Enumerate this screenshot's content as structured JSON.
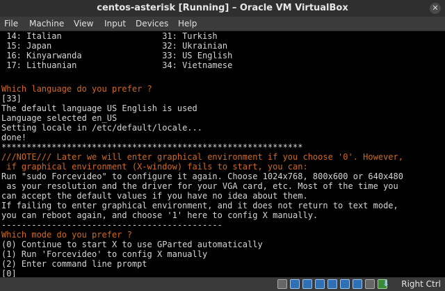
{
  "window": {
    "title": "centos-asterisk [Running] – Oracle VM VirtualBox",
    "close_glyph": "✕"
  },
  "menu": {
    "items": [
      "File",
      "Machine",
      "View",
      "Input",
      "Devices",
      "Help"
    ]
  },
  "console": {
    "lines": [
      {
        "text": " 14: Italian                    31: Turkish",
        "color": "white"
      },
      {
        "text": " 15: Japan                      32: Ukrainian",
        "color": "white"
      },
      {
        "text": " 16: Kinyarwanda                33: US English",
        "color": "white"
      },
      {
        "text": " 17: Lithuanian                 34: Vietnamese",
        "color": "white"
      },
      {
        "text": "",
        "color": "white"
      },
      {
        "text": "",
        "color": "white"
      },
      {
        "text": "Which language do you prefer ?",
        "color": "orange"
      },
      {
        "text": "[33]",
        "color": "white"
      },
      {
        "text": "The default language US English is used",
        "color": "white"
      },
      {
        "text": "Language selected en_US",
        "color": "white"
      },
      {
        "text": "Setting locale in /etc/default/locale...",
        "color": "white"
      },
      {
        "text": "done!",
        "color": "white"
      },
      {
        "text": "************************************************************",
        "color": "white"
      },
      {
        "text": "///NOTE/// Later we will enter graphical environment if you choose '0'. However,",
        "color": "orange"
      },
      {
        "text": " if graphical environment (X-window) fails to start, you can:",
        "color": "orange"
      },
      {
        "text": "Run \"sudo Forcevideo\" to configure it again. Choose 1024x768, 800x600 or 640x480",
        "color": "white"
      },
      {
        "text": " as your resolution and the driver for your VGA card, etc. Most of the time you",
        "color": "white"
      },
      {
        "text": "can accept the default values if you have no idea about them.",
        "color": "white"
      },
      {
        "text": "If failing to enter graphical environment, and it does not return to text mode,",
        "color": "white"
      },
      {
        "text": "you can reboot again, and choose '1' here to config X manually.",
        "color": "white"
      },
      {
        "text": "--------------------------------------------",
        "color": "white"
      },
      {
        "text": "Which mode do you prefer ?",
        "color": "orange"
      },
      {
        "text": "(0) Continue to start X to use GParted automatically",
        "color": "white"
      },
      {
        "text": "(1) Run 'Forcevideo' to config X manually",
        "color": "white"
      },
      {
        "text": "(2) Enter command line prompt",
        "color": "white"
      },
      {
        "text": "[0] _",
        "color": "white"
      }
    ]
  },
  "status": {
    "host_key": "Right Ctrl",
    "icons": [
      "hard-disk-icon",
      "optical-drive-icon",
      "audio-icon",
      "network-icon",
      "usb-icon",
      "shared-folder-icon",
      "display-icon",
      "video-capture-icon",
      "mouse-integration-icon",
      "cpu-activity-icon"
    ],
    "arrow_glyph": "⬇"
  }
}
